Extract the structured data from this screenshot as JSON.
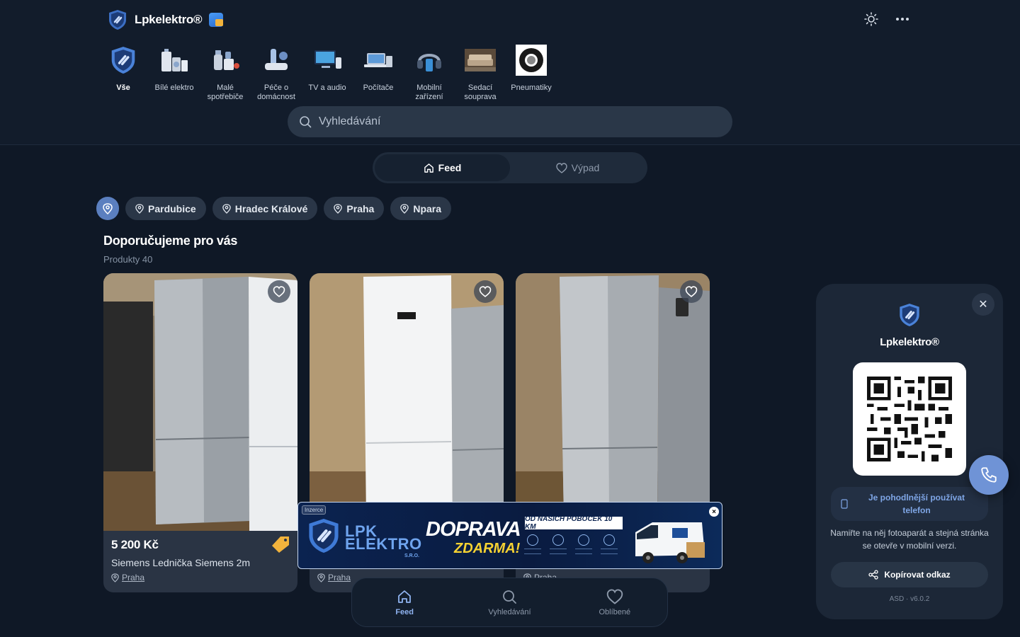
{
  "header": {
    "brand": "Lpkelektro®",
    "theme_icon": "sun-icon",
    "more_icon": "more-horizontal-icon"
  },
  "categories": [
    {
      "label": "Vše",
      "icon": "shield-plug-icon",
      "active": true
    },
    {
      "label": "Bílé elektro",
      "icon": "appliances-icon"
    },
    {
      "label": "Malé spotřebiče",
      "icon": "small-appliances-icon"
    },
    {
      "label": "Péče o domácnost",
      "icon": "home-care-icon"
    },
    {
      "label": "TV a audio",
      "icon": "tv-icon"
    },
    {
      "label": "Počítače",
      "icon": "computer-icon"
    },
    {
      "label": "Mobilní zařízení",
      "icon": "mobile-icon"
    },
    {
      "label": "Sedací souprava",
      "icon": "sofa-icon"
    },
    {
      "label": "Pneumatiky",
      "icon": "tire-icon"
    }
  ],
  "search": {
    "placeholder": "Vyhledávání"
  },
  "toggle": {
    "feed": "Feed",
    "vypad": "Výpad"
  },
  "locations": [
    "Pardubice",
    "Hradec Králové",
    "Praha",
    "Npara"
  ],
  "section": {
    "title": "Doporučujeme pro vás",
    "subtitle": "Produkty 40"
  },
  "products": [
    {
      "price": "5 200 Kč",
      "title": "Siemens Lednička Siemens 2m",
      "location": "Praha"
    },
    {
      "price": "",
      "title": "",
      "location": "Praha"
    },
    {
      "price": "",
      "title": "",
      "location": "Praha"
    }
  ],
  "banner": {
    "badge": "Inzerce",
    "brand_line1": "LPK",
    "brand_line2": "ELEKTRO",
    "brand_sro": "S.R.O.",
    "headline1": "DOPRAVA",
    "headline2": "ZDARMA!",
    "strip": "OD NAŠICH POBOČEK 10 KM",
    "close": "×"
  },
  "bottom_nav": [
    {
      "label": "Feed",
      "icon": "home-icon",
      "active": true
    },
    {
      "label": "Vyhledávání",
      "icon": "search-icon"
    },
    {
      "label": "Oblíbené",
      "icon": "heart-icon"
    }
  ],
  "qr_panel": {
    "name": "Lpkelektro®",
    "hint": "Je pohodlnější používat telefon",
    "description": "Namiřte na něj fotoaparát a stejná stránka se otevře v mobilní verzi.",
    "copy_label": "Kopírovat odkaz",
    "version": "ASD · v6.0.2"
  },
  "colors": {
    "accent": "#6f93d6",
    "background": "#0f1826",
    "banner_yellow": "#f6d232"
  }
}
